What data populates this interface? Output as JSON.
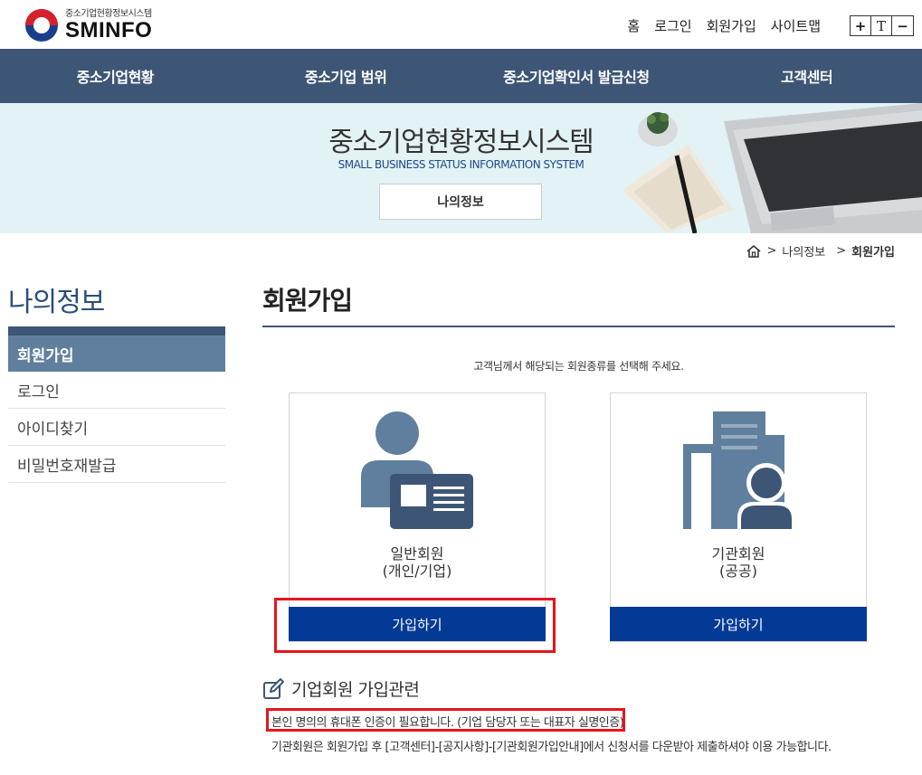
{
  "header": {
    "logo_sub": "중소기업현황정보시스템",
    "logo_main": "SMINFO",
    "util_links": [
      "홈",
      "로그인",
      "회원가입",
      "사이트맵"
    ],
    "font_controls": [
      "+",
      "T",
      "−"
    ]
  },
  "main_nav": [
    "중소기업현황",
    "중소기업 범위",
    "중소기업확인서 발급신청",
    "고객센터"
  ],
  "banner": {
    "title": "중소기업현황정보시스템",
    "subtitle": "SMALL BUSINESS STATUS INFORMATION SYSTEM",
    "button": "나의정보"
  },
  "breadcrumb": {
    "parent": "나의정보",
    "current": "회원가입"
  },
  "sidebar": {
    "title": "나의정보",
    "items": [
      {
        "label": "회원가입"
      },
      {
        "label": "로그인"
      },
      {
        "label": "아이디찾기"
      },
      {
        "label": "비밀번호재발급"
      }
    ]
  },
  "content": {
    "title": "회원가입",
    "guide": "고객님께서 해당되는 회원종류를 선택해 주세요.",
    "cards": [
      {
        "line1": "일반회원",
        "line2": "(개인/기업)",
        "button": "가입하기"
      },
      {
        "line1": "기관회원",
        "line2": "(공공)",
        "button": "가입하기"
      }
    ],
    "section_title": "기업회원 가입관련",
    "notes": [
      "본인 명의의 휴대폰 인증이 필요합니다. (기업 담당자 또는 대표자 실명인증)",
      "기관회원은 회원가입 후 [고객센터]-[공지사항]-[기관회원가입안내]에서 신청서를 다운받아 제출하셔야 이용 가능합니다."
    ]
  },
  "colors": {
    "nav_bg": "#3e5676",
    "banner_bg": "#e3f2f4",
    "button_blue": "#023a95",
    "active_menu": "#607f9e",
    "highlight_red": "#e8141c"
  }
}
